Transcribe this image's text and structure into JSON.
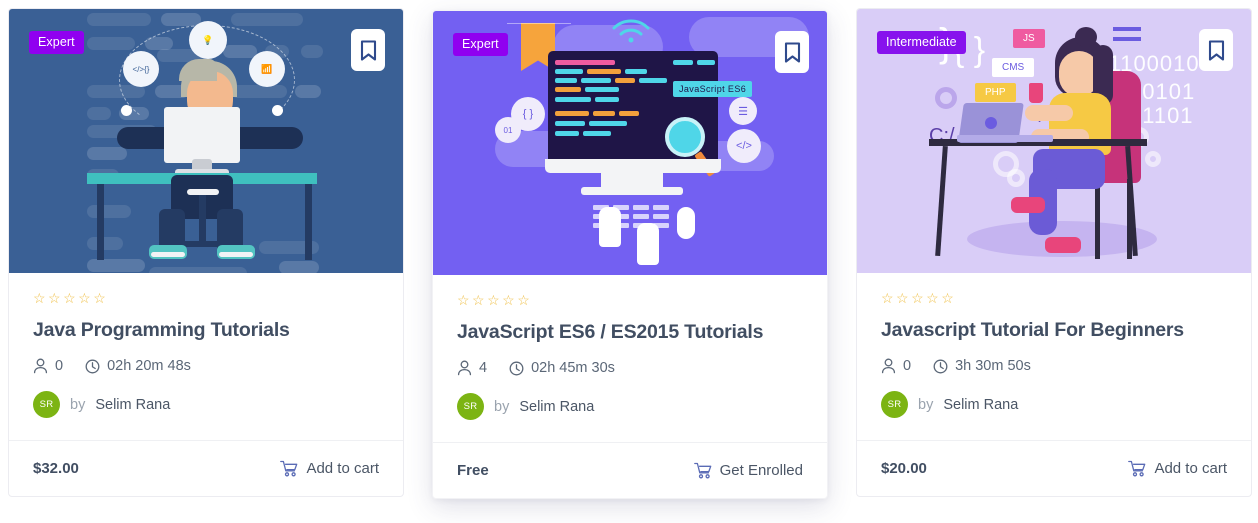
{
  "cards": [
    {
      "badge": "Expert",
      "badge_color": "#9000f0",
      "bookmark_icon": "bookmark-icon",
      "illustration": "developer-at-desk-illustration",
      "rating_stars": "☆☆☆☆☆",
      "title": "Java Programming Tutorials",
      "students": "0",
      "students_icon": "user-icon",
      "duration": "02h 20m 48s",
      "duration_icon": "clock-icon",
      "avatar_initials": "SR",
      "by_label": "by",
      "author": "Selim Rana",
      "price": "$32.00",
      "action_label": "Add to cart",
      "action_icon": "cart-icon"
    },
    {
      "badge": "Expert",
      "badge_color": "#9000f0",
      "bookmark_icon": "bookmark-icon",
      "illustration": "imac-code-editor-illustration",
      "screen_label": "JavaScript ES6",
      "rating_stars": "☆☆☆☆☆",
      "title": "JavaScript ES6 / ES2015 Tutorials",
      "students": "4",
      "students_icon": "user-icon",
      "duration": "02h 45m 30s",
      "duration_icon": "clock-icon",
      "avatar_initials": "SR",
      "by_label": "by",
      "author": "Selim Rana",
      "price": "Free",
      "action_label": "Get Enrolled",
      "action_icon": "cart-icon"
    },
    {
      "badge": "Intermediate",
      "badge_color": "#8712ed",
      "bookmark_icon": "bookmark-icon",
      "illustration": "woman-with-laptop-illustration",
      "tag_js": "JS",
      "tag_cms": "CMS",
      "tag_php": "PHP",
      "tag_path": "C:/",
      "binary_1": "11100010",
      "binary_2": "00101",
      "binary_3": "01101",
      "rating_stars": "☆☆☆☆☆",
      "title": "Javascript Tutorial For Beginners",
      "students": "0",
      "students_icon": "user-icon",
      "duration": "3h 30m 50s",
      "duration_icon": "clock-icon",
      "avatar_initials": "SR",
      "by_label": "by",
      "author": "Selim Rana",
      "price": "$20.00",
      "action_label": "Add to cart",
      "action_icon": "cart-icon"
    }
  ],
  "theme": {
    "star_color": "#f0c14b",
    "avatar_color": "#7cb413",
    "title_color": "#414e62",
    "card1_bg": "#3a6095",
    "card2_bg": "#7360f2",
    "card3_bg": "#d9cdf7"
  }
}
